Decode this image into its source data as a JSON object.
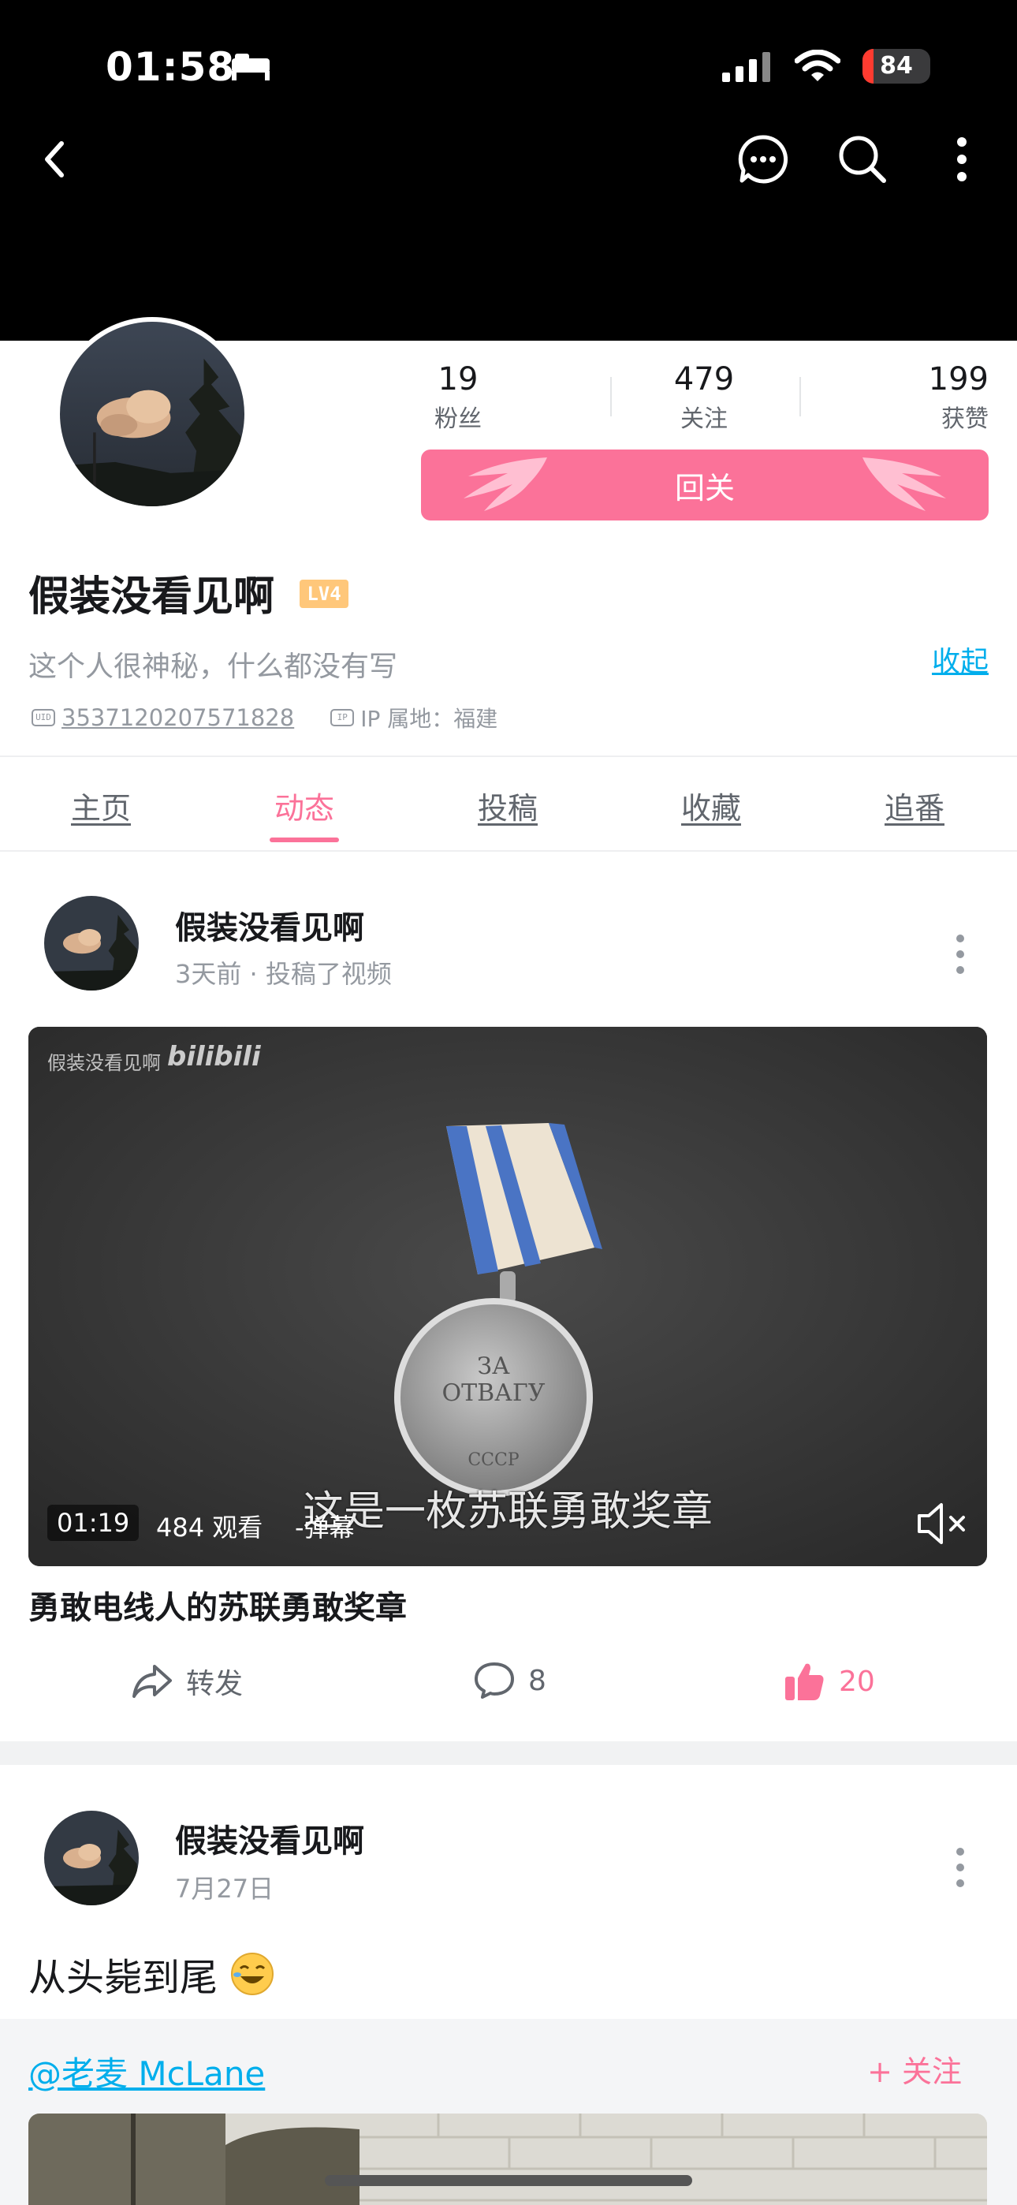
{
  "status_bar": {
    "time": "01:58",
    "battery": "84"
  },
  "profile": {
    "followers_count": "19",
    "followers_label": "粉丝",
    "following_count": "479",
    "following_label": "关注",
    "likes_count": "199",
    "likes_label": "获赞",
    "follow_back_label": "回关",
    "username": "假装没看见啊",
    "level": "LV4",
    "bio": "这个人很神秘，什么都没有写",
    "collapse_label": "收起",
    "uid_tag": "UID",
    "uid": "3537120207571828",
    "ip_tag": "IP",
    "ip_location": "IP 属地：福建"
  },
  "tabs": [
    {
      "label": "主页"
    },
    {
      "label": "动态"
    },
    {
      "label": "投稿"
    },
    {
      "label": "收藏"
    },
    {
      "label": "追番"
    }
  ],
  "active_tab": "动态",
  "posts": [
    {
      "author": "假装没看见啊",
      "meta": "3天前 · 投稿了视频",
      "video": {
        "watermark": "假装没看见啊",
        "watermark_logo": "bilibili",
        "subtitle": "这是一枚苏联勇敢奖章",
        "duration": "01:19",
        "views": "484 观看",
        "danmaku": "-弹幕"
      },
      "title": "勇敢电线人的苏联勇敢奖章",
      "share_label": "转发",
      "comment_count": "8",
      "like_count": "20"
    },
    {
      "author": "假装没看见啊",
      "meta": "7月27日",
      "text": "从头毙到尾",
      "repost_mention": "@老麦 McLane",
      "repost_follow_label": "+ 关注"
    }
  ],
  "colors": {
    "accent_pink": "#fb7299",
    "link_blue": "#00aeec",
    "level_badge": "#ffc77a"
  }
}
